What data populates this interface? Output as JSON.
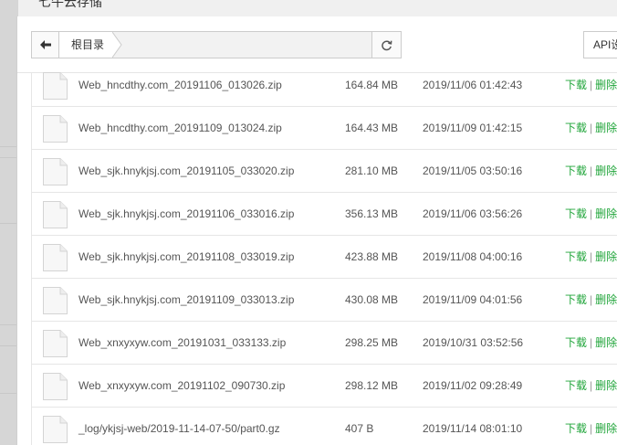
{
  "window": {
    "title": "七牛云存储"
  },
  "toolbar": {
    "breadcrumb_root": "根目录",
    "api_button_label": "API设"
  },
  "icons": {
    "back": "arrow-left-icon",
    "refresh": "refresh-icon",
    "file": "file-icon"
  },
  "colors": {
    "link": "#20a53a",
    "border": "#e6e6e6",
    "text": "#555555"
  },
  "files": [
    {
      "name": "Web_hncdthy.com_20191106_013026.zip",
      "size": "164.84 MB",
      "time": "2019/11/06 01:42:43",
      "download": "下载",
      "delete": "删除"
    },
    {
      "name": "Web_hncdthy.com_20191109_013024.zip",
      "size": "164.43 MB",
      "time": "2019/11/09 01:42:15",
      "download": "下载",
      "delete": "删除"
    },
    {
      "name": "Web_sjk.hnykjsj.com_20191105_033020.zip",
      "size": "281.10 MB",
      "time": "2019/11/05 03:50:16",
      "download": "下载",
      "delete": "删除"
    },
    {
      "name": "Web_sjk.hnykjsj.com_20191106_033016.zip",
      "size": "356.13 MB",
      "time": "2019/11/06 03:56:26",
      "download": "下载",
      "delete": "删除"
    },
    {
      "name": "Web_sjk.hnykjsj.com_20191108_033019.zip",
      "size": "423.88 MB",
      "time": "2019/11/08 04:00:16",
      "download": "下载",
      "delete": "删除"
    },
    {
      "name": "Web_sjk.hnykjsj.com_20191109_033013.zip",
      "size": "430.08 MB",
      "time": "2019/11/09 04:01:56",
      "download": "下载",
      "delete": "删除"
    },
    {
      "name": "Web_xnxyxyw.com_20191031_033133.zip",
      "size": "298.25 MB",
      "time": "2019/10/31 03:52:56",
      "download": "下载",
      "delete": "删除"
    },
    {
      "name": "Web_xnxyxyw.com_20191102_090730.zip",
      "size": "298.12 MB",
      "time": "2019/11/02 09:28:49",
      "download": "下载",
      "delete": "删除"
    },
    {
      "name": "_log/ykjsj-web/2019-11-14-07-50/part0.gz",
      "size": "407 B",
      "time": "2019/11/14 08:01:10",
      "download": "下载",
      "delete": "删除"
    }
  ]
}
